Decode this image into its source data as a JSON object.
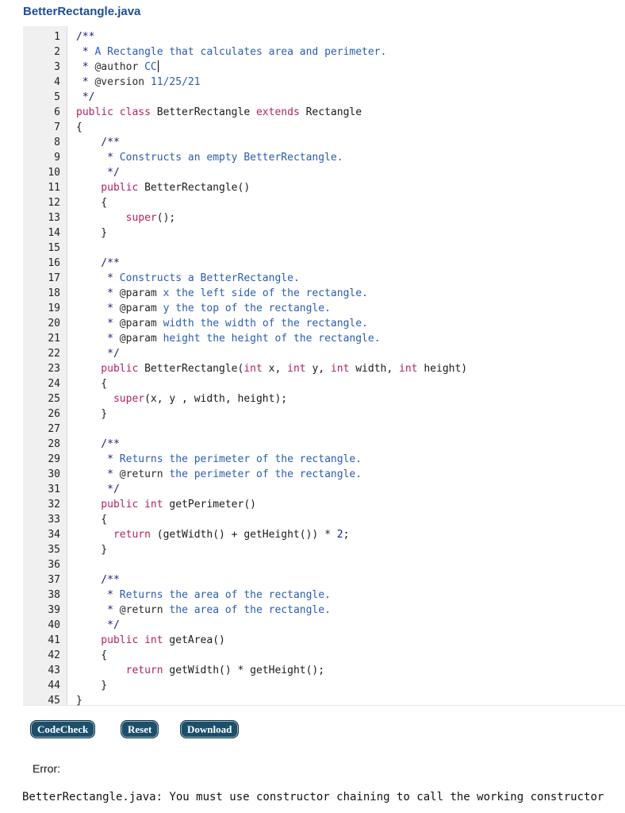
{
  "file_title": "BetterRectangle.java",
  "lines": [
    {
      "n": "1",
      "t": [
        [
          "comment",
          "/**"
        ]
      ]
    },
    {
      "n": "2",
      "t": [
        [
          "comment",
          " * "
        ],
        [
          "commenttext",
          "A Rectangle that calculates area and perimeter."
        ]
      ]
    },
    {
      "n": "3",
      "t": [
        [
          "comment",
          " * "
        ],
        [
          "tag",
          "@author"
        ],
        [
          "commenttext",
          " CC"
        ]
      ],
      "cursor": true
    },
    {
      "n": "4",
      "t": [
        [
          "comment",
          " * "
        ],
        [
          "tag",
          "@version"
        ],
        [
          "commenttext",
          " 11/25/21"
        ]
      ]
    },
    {
      "n": "5",
      "t": [
        [
          "comment",
          " */"
        ]
      ]
    },
    {
      "n": "6",
      "t": [
        [
          "keyword",
          "public class "
        ],
        [
          "plain",
          "BetterRectangle "
        ],
        [
          "keyword",
          "extends "
        ],
        [
          "plain",
          "Rectangle"
        ]
      ]
    },
    {
      "n": "7",
      "t": [
        [
          "plain",
          "{"
        ]
      ]
    },
    {
      "n": "8",
      "t": [
        [
          "comment",
          "    /**"
        ]
      ]
    },
    {
      "n": "9",
      "t": [
        [
          "comment",
          "     * "
        ],
        [
          "commenttext",
          "Constructs an empty BetterRectangle."
        ]
      ]
    },
    {
      "n": "10",
      "t": [
        [
          "comment",
          "     */"
        ]
      ]
    },
    {
      "n": "11",
      "t": [
        [
          "keyword",
          "    public "
        ],
        [
          "plain",
          "BetterRectangle()"
        ]
      ]
    },
    {
      "n": "12",
      "t": [
        [
          "plain",
          "    {"
        ]
      ]
    },
    {
      "n": "13",
      "t": [
        [
          "keyword",
          "        super"
        ],
        [
          "plain",
          "();"
        ]
      ]
    },
    {
      "n": "14",
      "t": [
        [
          "plain",
          "    }"
        ]
      ]
    },
    {
      "n": "15",
      "t": []
    },
    {
      "n": "16",
      "t": [
        [
          "comment",
          "    /**"
        ]
      ]
    },
    {
      "n": "17",
      "t": [
        [
          "comment",
          "     * "
        ],
        [
          "commenttext",
          "Constructs a BetterRectangle."
        ]
      ]
    },
    {
      "n": "18",
      "t": [
        [
          "comment",
          "     * "
        ],
        [
          "tag",
          "@param"
        ],
        [
          "commenttext",
          " x the left side of the rectangle."
        ]
      ]
    },
    {
      "n": "19",
      "t": [
        [
          "comment",
          "     * "
        ],
        [
          "tag",
          "@param"
        ],
        [
          "commenttext",
          " y the top of the rectangle."
        ]
      ]
    },
    {
      "n": "20",
      "t": [
        [
          "comment",
          "     * "
        ],
        [
          "tag",
          "@param"
        ],
        [
          "commenttext",
          " width the width of the rectangle."
        ]
      ]
    },
    {
      "n": "21",
      "t": [
        [
          "comment",
          "     * "
        ],
        [
          "tag",
          "@param"
        ],
        [
          "commenttext",
          " height the height of the rectangle."
        ]
      ]
    },
    {
      "n": "22",
      "t": [
        [
          "comment",
          "     */"
        ]
      ]
    },
    {
      "n": "23",
      "t": [
        [
          "keyword",
          "    public "
        ],
        [
          "plain",
          "BetterRectangle("
        ],
        [
          "keyword",
          "int "
        ],
        [
          "plain",
          "x, "
        ],
        [
          "keyword",
          "int "
        ],
        [
          "plain",
          "y, "
        ],
        [
          "keyword",
          "int "
        ],
        [
          "plain",
          "width, "
        ],
        [
          "keyword",
          "int "
        ],
        [
          "plain",
          "height)"
        ]
      ]
    },
    {
      "n": "24",
      "t": [
        [
          "plain",
          "    {"
        ]
      ]
    },
    {
      "n": "25",
      "t": [
        [
          "keyword",
          "      super"
        ],
        [
          "plain",
          "(x, y , width, height);"
        ]
      ]
    },
    {
      "n": "26",
      "t": [
        [
          "plain",
          "    }"
        ]
      ]
    },
    {
      "n": "27",
      "t": []
    },
    {
      "n": "28",
      "t": [
        [
          "comment",
          "    /**"
        ]
      ]
    },
    {
      "n": "29",
      "t": [
        [
          "comment",
          "     * "
        ],
        [
          "commenttext",
          "Returns the perimeter of the rectangle."
        ]
      ]
    },
    {
      "n": "30",
      "t": [
        [
          "comment",
          "     * "
        ],
        [
          "tag",
          "@return"
        ],
        [
          "commenttext",
          " the perimeter of the rectangle."
        ]
      ]
    },
    {
      "n": "31",
      "t": [
        [
          "comment",
          "     */"
        ]
      ]
    },
    {
      "n": "32",
      "t": [
        [
          "keyword",
          "    public int "
        ],
        [
          "plain",
          "getPerimeter()"
        ]
      ]
    },
    {
      "n": "33",
      "t": [
        [
          "plain",
          "    {"
        ]
      ]
    },
    {
      "n": "34",
      "t": [
        [
          "keyword",
          "      return "
        ],
        [
          "plain",
          "(getWidth() + getHeight()) * "
        ],
        [
          "number",
          "2"
        ],
        [
          "plain",
          ";"
        ]
      ]
    },
    {
      "n": "35",
      "t": [
        [
          "plain",
          "    }"
        ]
      ]
    },
    {
      "n": "36",
      "t": []
    },
    {
      "n": "37",
      "t": [
        [
          "comment",
          "    /**"
        ]
      ]
    },
    {
      "n": "38",
      "t": [
        [
          "comment",
          "     * "
        ],
        [
          "commenttext",
          "Returns the area of the rectangle."
        ]
      ]
    },
    {
      "n": "39",
      "t": [
        [
          "comment",
          "     * "
        ],
        [
          "tag",
          "@return"
        ],
        [
          "commenttext",
          " the area of the rectangle."
        ]
      ]
    },
    {
      "n": "40",
      "t": [
        [
          "comment",
          "     */"
        ]
      ]
    },
    {
      "n": "41",
      "t": [
        [
          "keyword",
          "    public int "
        ],
        [
          "plain",
          "getArea()"
        ]
      ]
    },
    {
      "n": "42",
      "t": [
        [
          "plain",
          "    {"
        ]
      ]
    },
    {
      "n": "43",
      "t": [
        [
          "keyword",
          "        return "
        ],
        [
          "plain",
          "getWidth() * getHeight();"
        ]
      ]
    },
    {
      "n": "44",
      "t": [
        [
          "plain",
          "    }"
        ]
      ]
    },
    {
      "n": "45",
      "t": [
        [
          "plain",
          "}"
        ]
      ]
    }
  ],
  "buttons": {
    "codecheck": "CodeCheck",
    "reset": "Reset",
    "download": "Download"
  },
  "error": {
    "label": "Error:",
    "message": "BetterRectangle.java: You must use constructor chaining to call the working constructor"
  },
  "colors": {
    "title": "#1f4e91",
    "keyword": "#b22265",
    "comment_text": "#2a5db0",
    "button_bg": "#1b4f6b"
  }
}
